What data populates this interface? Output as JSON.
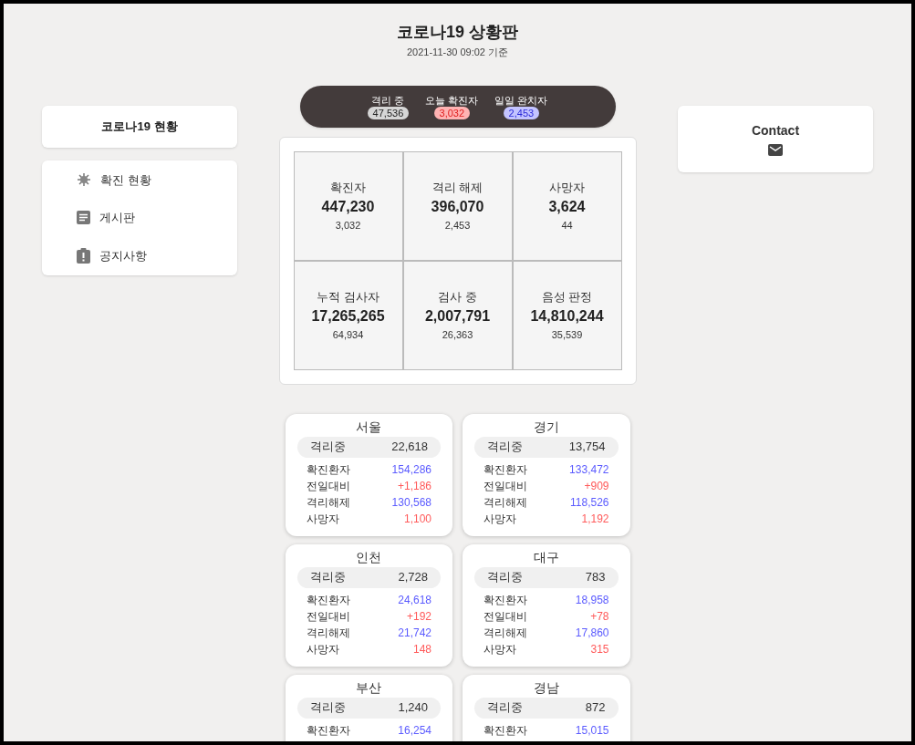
{
  "header": {
    "title": "코로나19 상황판",
    "updated": "2021-11-30 09:02 기준"
  },
  "summary": [
    {
      "label": "격리 중",
      "value": "47,536",
      "kind": "neutral"
    },
    {
      "label": "오늘 확진자",
      "value": "3,032",
      "kind": "confirmed"
    },
    {
      "label": "일일 완치자",
      "value": "2,453",
      "kind": "recovered"
    }
  ],
  "sidebar": {
    "title": "코로나19 현황",
    "items": [
      {
        "label": "확진 현황",
        "kind": "virus"
      },
      {
        "label": "게시판",
        "kind": "board"
      },
      {
        "label": "공지사항",
        "kind": "notice"
      }
    ]
  },
  "contact": {
    "title": "Contact"
  },
  "stats": [
    {
      "label": "확진자",
      "value": "447,230",
      "change": "3,032"
    },
    {
      "label": "격리 해제",
      "value": "396,070",
      "change": "2,453"
    },
    {
      "label": "사망자",
      "value": "3,624",
      "change": "44"
    },
    {
      "label": "누적 검사자",
      "value": "17,265,265",
      "change": "64,934"
    },
    {
      "label": "검사 중",
      "value": "2,007,791",
      "change": "26,363"
    },
    {
      "label": "음성 판정",
      "value": "14,810,244",
      "change": "35,539"
    }
  ],
  "regions": [
    {
      "name": "서울",
      "isolating_label": "격리중",
      "isolating": "22,618",
      "rows": [
        {
          "label": "확진환자",
          "value": "154,286",
          "kind": "count"
        },
        {
          "label": "전일대비",
          "value": "+1,186",
          "kind": "alert"
        },
        {
          "label": "격리해제",
          "value": "130,568",
          "kind": "count"
        },
        {
          "label": "사망자",
          "value": "1,100",
          "kind": "alert"
        }
      ]
    },
    {
      "name": "경기",
      "isolating_label": "격리중",
      "isolating": "13,754",
      "rows": [
        {
          "label": "확진환자",
          "value": "133,472",
          "kind": "count"
        },
        {
          "label": "전일대비",
          "value": "+909",
          "kind": "alert"
        },
        {
          "label": "격리해제",
          "value": "118,526",
          "kind": "count"
        },
        {
          "label": "사망자",
          "value": "1,192",
          "kind": "alert"
        }
      ]
    },
    {
      "name": "인천",
      "isolating_label": "격리중",
      "isolating": "2,728",
      "rows": [
        {
          "label": "확진환자",
          "value": "24,618",
          "kind": "count"
        },
        {
          "label": "전일대비",
          "value": "+192",
          "kind": "alert"
        },
        {
          "label": "격리해제",
          "value": "21,742",
          "kind": "count"
        },
        {
          "label": "사망자",
          "value": "148",
          "kind": "alert"
        }
      ]
    },
    {
      "name": "대구",
      "isolating_label": "격리중",
      "isolating": "783",
      "rows": [
        {
          "label": "확진환자",
          "value": "18,958",
          "kind": "count"
        },
        {
          "label": "전일대비",
          "value": "+78",
          "kind": "alert"
        },
        {
          "label": "격리해제",
          "value": "17,860",
          "kind": "count"
        },
        {
          "label": "사망자",
          "value": "315",
          "kind": "alert"
        }
      ]
    },
    {
      "name": "부산",
      "isolating_label": "격리중",
      "isolating": "1,240",
      "rows": [
        {
          "label": "확진환자",
          "value": "16,254",
          "kind": "count"
        }
      ]
    },
    {
      "name": "경남",
      "isolating_label": "격리중",
      "isolating": "872",
      "rows": [
        {
          "label": "확진환자",
          "value": "15,015",
          "kind": "count"
        }
      ]
    }
  ]
}
